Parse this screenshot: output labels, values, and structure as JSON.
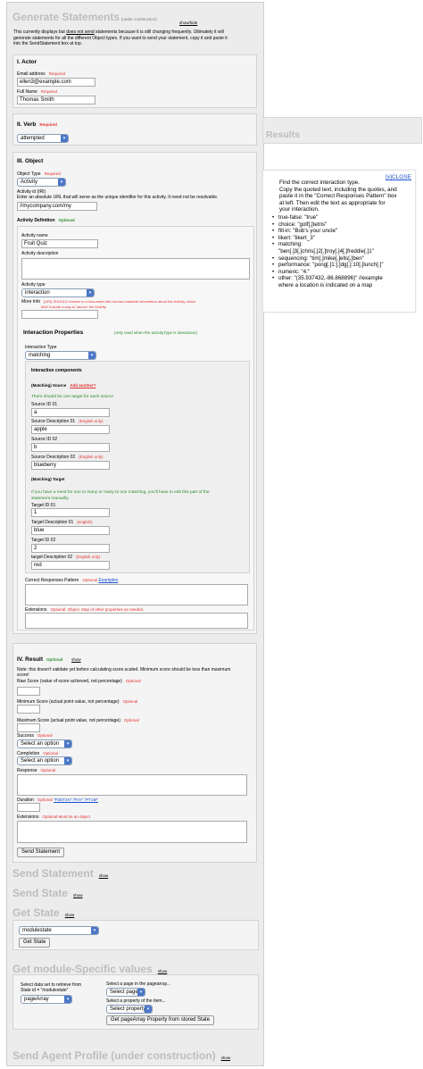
{
  "generate": {
    "title": "Generate Statements",
    "subtitle": "(under construction)",
    "show": "show/hide",
    "intro_line1": "This currently displays but ",
    "intro_not": "does not send",
    "intro_line1b": " statements because it is still changing frequently. Ultimately it will",
    "intro_line2": "generate statements for all the different Object types. If you want to send your statement, copy it and paste it",
    "intro_line3": "into the SendStatement box at top."
  },
  "actor": {
    "title": "I. Actor",
    "email_label": "Email address",
    "email_req": "Required",
    "email_value": "ellen3@example.com",
    "name_label": "Full Name",
    "name_req": "Required",
    "name_value": "Thomas Smith"
  },
  "verb": {
    "title": "II. Verb",
    "req": "Required",
    "value": "attempted"
  },
  "object": {
    "title": "III. Object",
    "type_label": "Object Type",
    "type_req": "Required",
    "type_value": "Activity",
    "id_label": "Activity id (IRI)",
    "id_note": "Enter an absolute URL that will serve as the unique identifier for this activity. It need not be resolvable.",
    "id_value": "//mycompany.com/my",
    "def_title": "Activity Definition",
    "def_opt": "Optional",
    "name_label": "Activity name",
    "name_value": "Fruit Quiz",
    "desc_label": "Activity description",
    "atype_label": "Activity type",
    "atype_value": "interaction",
    "moreinfo_label": "More Info",
    "moreinfo_note1": "[URI] SHOULD resolve to a document with human-readable information about the Activity, which",
    "moreinfo_note2": "MAY include a way to 'launch' the Activity."
  },
  "interaction": {
    "title": "Interaction Properties",
    "note": "(only used when the activityType is interaction)",
    "type_label": "Interaction Type",
    "type_value": "matching",
    "components_title": "Interaction components",
    "source_title": "(Matching) Source",
    "add_another": "Add another?",
    "source_note": "There should be one target for each source",
    "src1_id_label": "Source ID 01",
    "src1_id": "a",
    "src1_desc_label": "Source Description 01",
    "src1_eng": "(English only)",
    "src1_desc": "apple",
    "src2_id_label": "Source ID 02",
    "src2_id": "b",
    "src2_desc_label": "Source Description 02",
    "src2_eng": "(English only)",
    "src2_desc": "blueberry",
    "target_title": "(Matching) Target",
    "target_note1": "If you have a need for one to many or many to one matching, you'll have to edit this part of the",
    "target_note2": "statement manually.",
    "tgt1_id_label": "Target ID 01",
    "tgt1_id": "1",
    "tgt1_desc_label": "Target Description 01",
    "tgt1_eng": "(english)",
    "tgt1_desc": "blue",
    "tgt2_id_label": "Target ID 02",
    "tgt2_id": "2",
    "tgt2_desc_label": "target Description 02",
    "tgt2_eng": "(English only)",
    "tgt2_desc": "red",
    "crp_label": "Correct Responses Pattern",
    "crp_opt": "Optional",
    "crp_examples": "Examples",
    "ext_label": "Extensions",
    "ext_note": "Optional: Object. Map of other properties as needed."
  },
  "result": {
    "title": "IV. Result",
    "opt": "Optional",
    "show": "show",
    "note1": "Note: this doesn't validate yet before calculating score.scaled. Minimum score should be less than maximum",
    "note2": "score!",
    "raw_label": "Raw Score (value of score achieved, not percentage)",
    "raw_opt": "Optional",
    "min_label": "Minimum Score (actual point value, not percentage)",
    "min_opt": "Optional",
    "max_label": "Maximum Score (actual point value, not percentage)",
    "max_opt": "Optional",
    "success_label": "Success",
    "success_opt": "Optional",
    "success_value": "Select an option",
    "completion_label": "Completion",
    "completion_opt": "Optional",
    "completion_value": "Select an option",
    "response_label": "Response",
    "response_opt": "Optional",
    "duration_label": "Duration",
    "duration_opt": "Optional",
    "duration_ex": "\"P2DT2H\",\"P4Y\",\"PT1M\"",
    "ext_label": "Extensions",
    "ext_opt": "Optional Must be an object",
    "send_button": "Send Statement"
  },
  "send_statement": {
    "title": "Send Statement",
    "show": "show"
  },
  "send_state": {
    "title": "Send State",
    "show": "show"
  },
  "get_state": {
    "title": "Get State",
    "show": "show",
    "select_value": "modulestate",
    "button": "Get State"
  },
  "module_values": {
    "title": "Get module-Specific values",
    "show": "show",
    "data_label1": "Select data set to retrieve from",
    "data_label2": "State id = \"modulestate\"",
    "data_value": "pageArray",
    "page_label": "Select a page in the pagearray...",
    "page_value": "Select page",
    "prop_label": "Select a property of the item...",
    "prop_value": "Select property",
    "button": "Get pageArray Property from stored State"
  },
  "agent_profile": {
    "title": "Send Agent Profile (under construction)",
    "show": "show"
  },
  "results": {
    "title": "Results"
  },
  "help": {
    "close": "[x]CLOSE",
    "intro1": "Find the correct interaction type.",
    "intro2": "Copy the quoted text, including the quotes, and",
    "intro3": "paste it in the \"Correct Responses Pattern\" box",
    "intro4": "at left. Then edit the text as appropriate for",
    "intro5": "your interaction.",
    "items": [
      "true-false: \"true\"",
      "choice: \"golf[,]tetris\"",
      "fill-in: \"Bob's your uncle\"",
      "likert: \"likert_3\"",
      "matching:",
      "\"ben[.]3[,]chris[.]2[,]troy[.]4[,]freddie[.]1\"",
      "sequencing: \"tim[,]mike[,]ells[,]ben\"",
      "performance: \"pong[.]1:[,]dg[.]:10[,]lunch[.]\"",
      "numeric: \"4:\"",
      "other: \"(35.937432,-86.868896)\" //example",
      "where a location is indicated on a map"
    ]
  }
}
